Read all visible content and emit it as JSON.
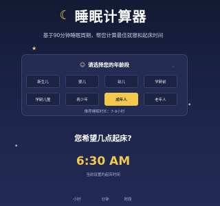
{
  "header": {
    "moon_icon": "crescent-moon-icon",
    "title": "睡眠计算器",
    "subtitle": "基于90分钟睡眠周期，帮您计算最佳就寝和起床时间"
  },
  "age_section": {
    "person_icon": "person-icon",
    "title": "请选择您的年龄段",
    "options": [
      "新生儿",
      "婴儿",
      "幼儿",
      "学龄前",
      "学龄儿童",
      "青少年",
      "成年人",
      "老年人"
    ],
    "selected": "成年人",
    "recommendation": "推荐睡眠时长：7-9小时"
  },
  "wake_section": {
    "question": "您希望几点起床?",
    "time": "6:30 AM",
    "caption": "当前设置的起床时间",
    "picker_labels": {
      "hour": "小时",
      "minute": "分钟",
      "ampm": "时段"
    }
  },
  "colors": {
    "accent": "#f2c94c",
    "background": "#1b2347",
    "card": "#262e55"
  }
}
